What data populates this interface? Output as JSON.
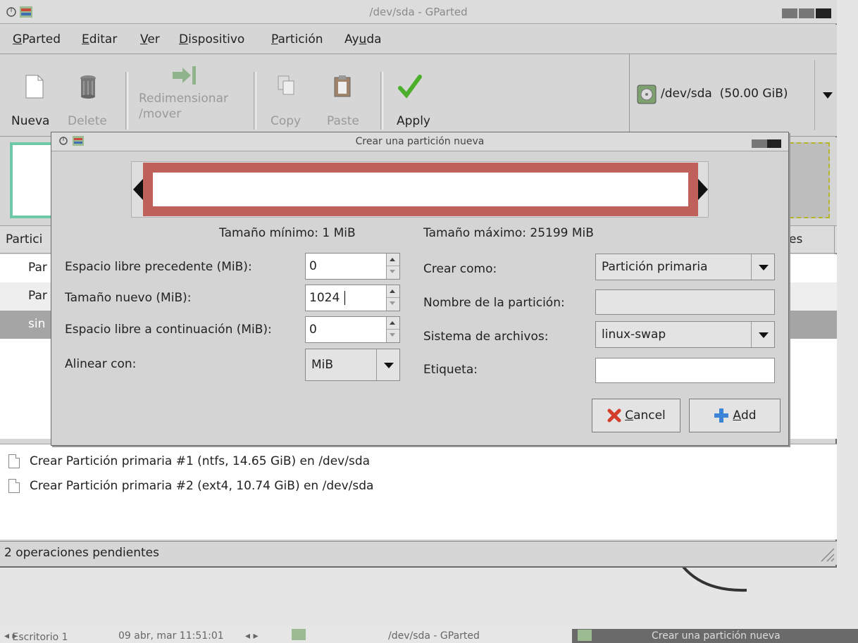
{
  "window": {
    "title": "/dev/sda - GParted"
  },
  "menu": [
    {
      "pre": "",
      "u": "G",
      "post": "Parted"
    },
    {
      "pre": "",
      "u": "E",
      "post": "ditar"
    },
    {
      "pre": "",
      "u": "V",
      "post": "er"
    },
    {
      "pre": "",
      "u": "D",
      "post": "ispositivo"
    },
    {
      "pre": "",
      "u": "P",
      "post": "artición"
    },
    {
      "pre": "Ay",
      "u": "u",
      "post": "da"
    }
  ],
  "toolbar": {
    "new": "Nueva",
    "delete": "Delete",
    "resize_1": "Redimensionar",
    "resize_2": "/mover",
    "copy": "Copy",
    "paste": "Paste",
    "apply": "Apply"
  },
  "device": {
    "label": "/dev/sda  (50.00 GiB)"
  },
  "list": {
    "header_left": "Partici",
    "header_right": "es",
    "rows": [
      "Par",
      "Par",
      "sin"
    ]
  },
  "operations": [
    "Crear Partición primaria #1 (ntfs, 14.65 GiB) en /dev/sda",
    "Crear Partición primaria #2 (ext4, 10.74 GiB) en /dev/sda"
  ],
  "status": "2 operaciones pendientes",
  "dialog": {
    "title": "Crear una partición nueva",
    "min_size": "Tamaño mínimo: 1 MiB",
    "max_size": "Tamaño máximo: 25199 MiB",
    "free_before_label": "Espacio libre precedente (MiB):",
    "free_before_value": "0",
    "new_size_label": "Tamaño nuevo (MiB):",
    "new_size_value": "1024",
    "free_after_label": "Espacio libre a continuación (MiB):",
    "free_after_value": "0",
    "align_label": "Alinear con:",
    "align_value": "MiB",
    "create_as_label": "Crear como:",
    "create_as_value": "Partición primaria",
    "name_label": "Nombre de la partición:",
    "fs_label": "Sistema de archivos:",
    "fs_value": "linux-swap",
    "label_label": "Etiqueta:",
    "cancel": {
      "u": "C",
      "post": "ancel"
    },
    "add": {
      "u": "A",
      "post": "dd"
    }
  },
  "taskbar": {
    "desktop": "Escritorio 1",
    "clock": "09 abr, mar 11:51:01",
    "task1": "/dev/sda - GParted",
    "task2": "Crear una partición nueva"
  },
  "colors": {
    "partition_bar": "#c0605a",
    "map_green": "#6ec9a6",
    "apply_check": "#4caf2c",
    "add_plus": "#3b83d6",
    "cancel_x": "#d43c2c"
  }
}
